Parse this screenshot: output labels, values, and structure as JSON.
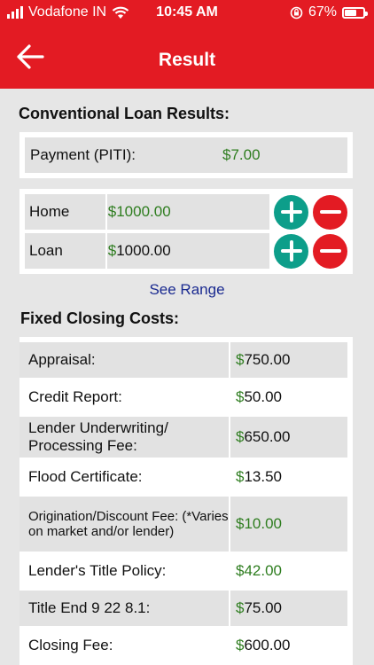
{
  "status": {
    "carrier": "Vodafone IN",
    "time": "10:45 AM",
    "battery": "67%",
    "battery_level": 0.67
  },
  "header": {
    "title": "Result"
  },
  "results": {
    "title": "Conventional Loan Results:",
    "payment_label": "Payment (PITI):",
    "payment_value": "$7.00"
  },
  "adjusters": [
    {
      "label": "Home",
      "value": "1000.00"
    },
    {
      "label": "Loan",
      "value": "1000.00"
    }
  ],
  "see_range": "See Range",
  "fixed_costs": {
    "title": "Fixed Closing Costs:",
    "rows": [
      {
        "label": "Appraisal:",
        "value": "750.00"
      },
      {
        "label": "Credit Report:",
        "value": "50.00"
      },
      {
        "label": "Lender Underwriting/ Processing Fee:",
        "value": "650.00"
      },
      {
        "label": "Flood Certificate:",
        "value": "13.50"
      },
      {
        "label": "Origination/Discount Fee: (*Varies on market and/or lender)",
        "value": "10.00"
      },
      {
        "label": "Lender's Title Policy:",
        "value": "42.00"
      },
      {
        "label": "Title End 9 22 8.1:",
        "value": "75.00"
      },
      {
        "label": "Closing Fee:",
        "value": "600.00"
      }
    ]
  },
  "colors": {
    "brand_red": "#e31b23",
    "plus_teal": "#0d9e8a",
    "value_green": "#2e7d1f",
    "link_blue": "#1a2a90"
  }
}
